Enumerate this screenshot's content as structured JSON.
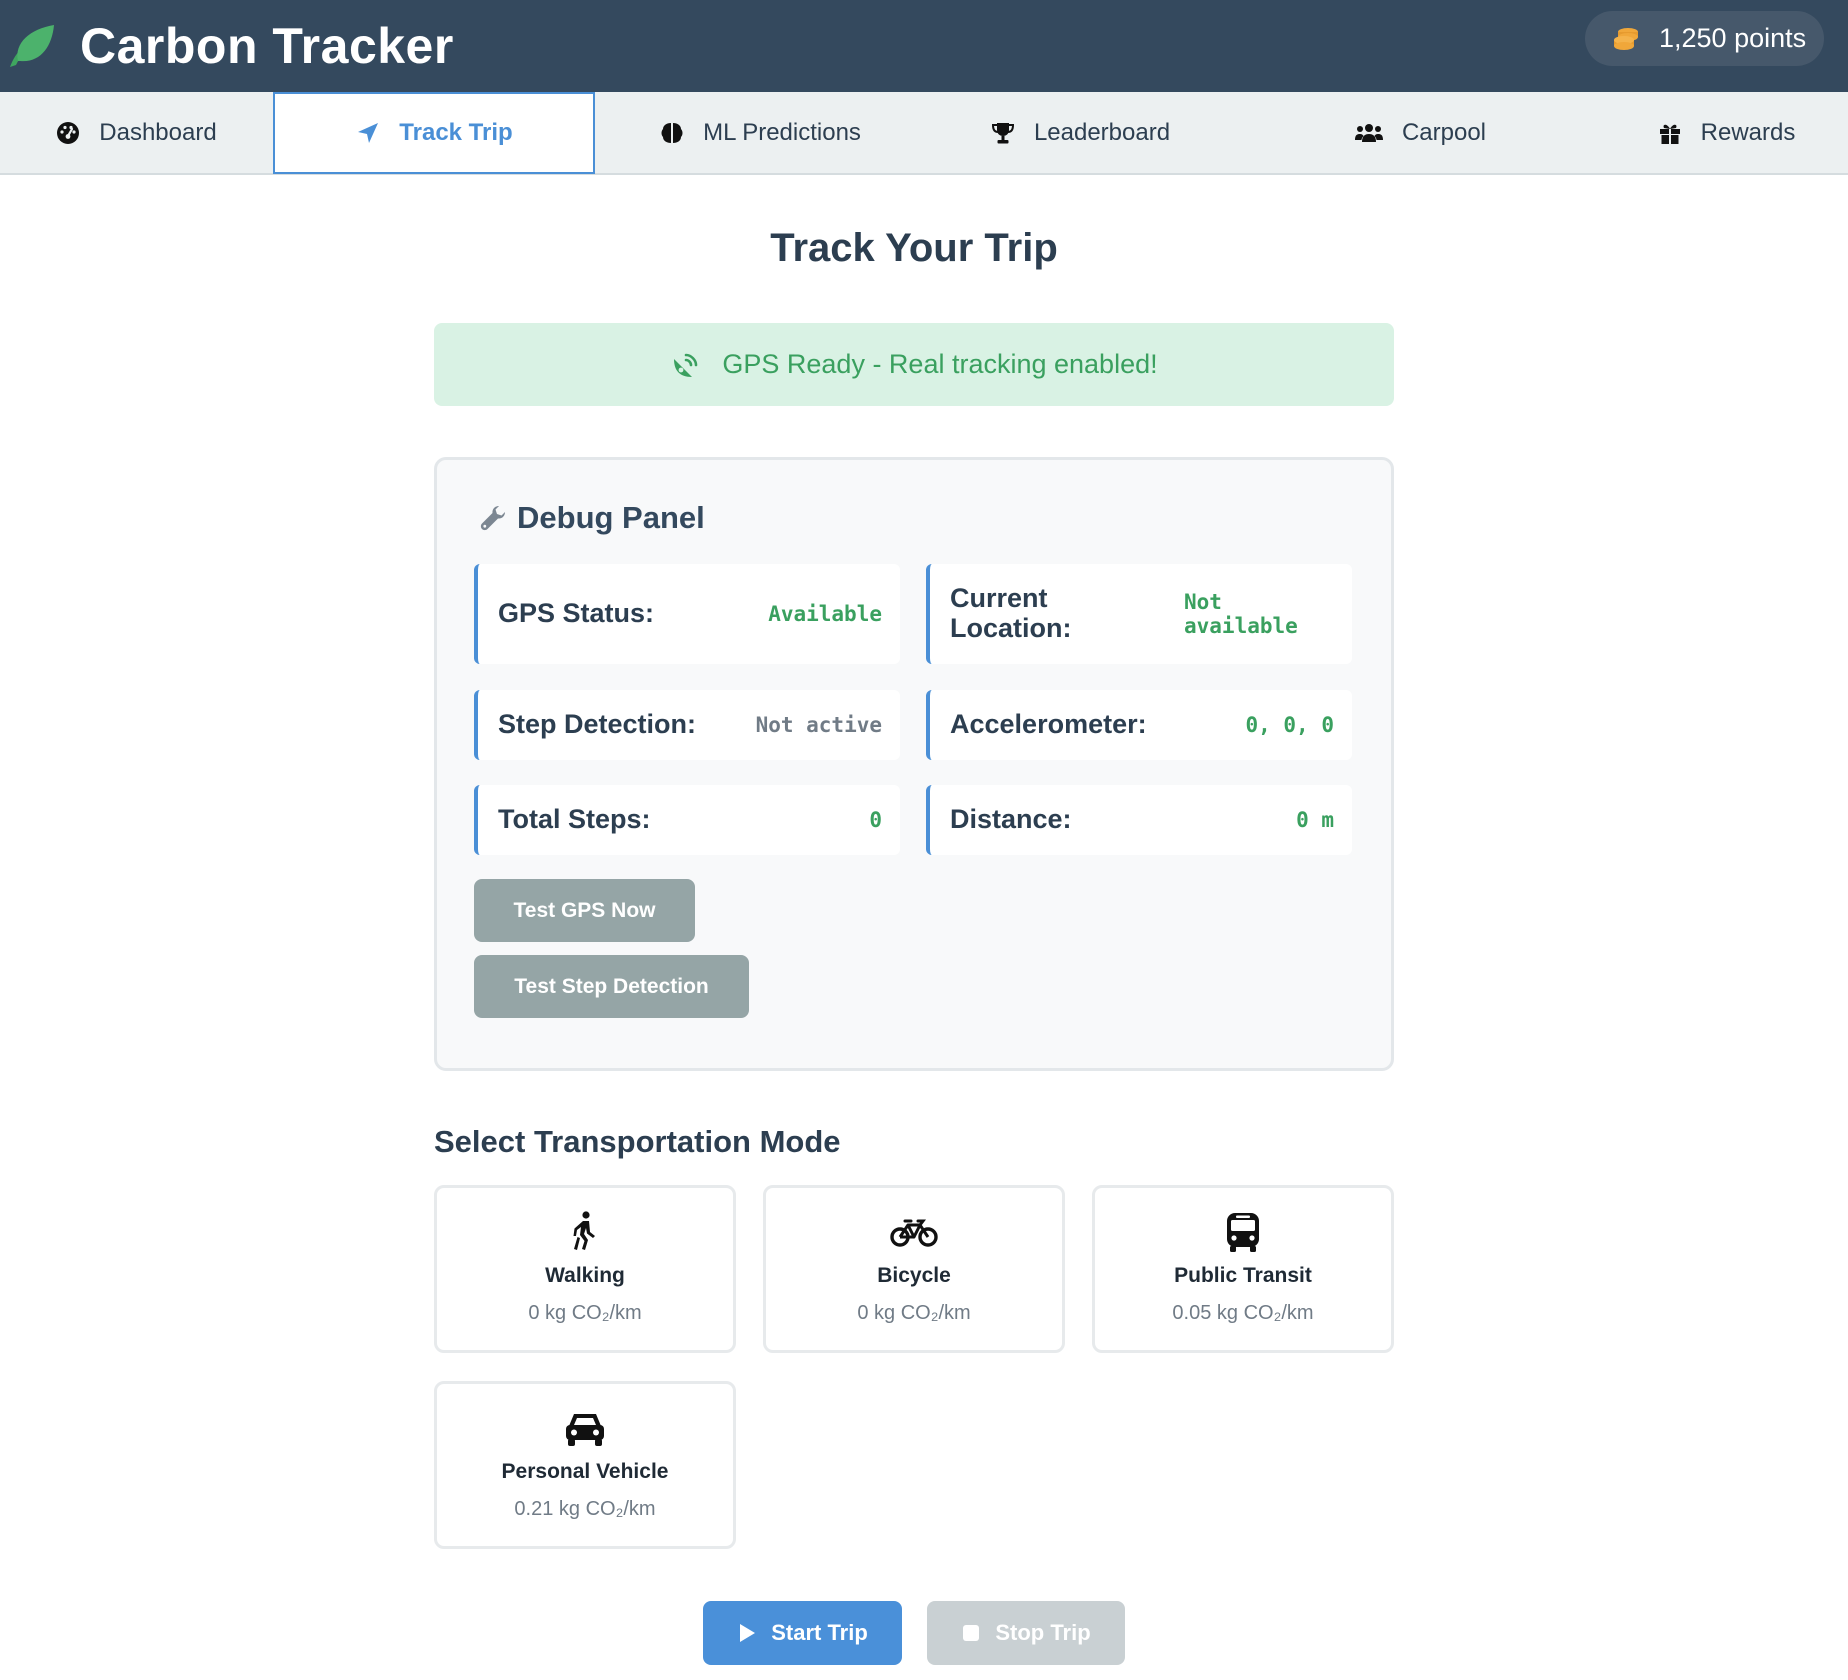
{
  "header": {
    "title": "Carbon Tracker",
    "points": "1,250 points",
    "logo_icon": "leaf-icon",
    "points_icon": "coins-icon",
    "colors": {
      "background": "#34495e",
      "accent": "#4a90d9",
      "success": "#3aa05f"
    }
  },
  "nav": {
    "tabs": [
      {
        "label": "Dashboard",
        "icon": "gauge-icon"
      },
      {
        "label": "Track Trip",
        "icon": "location-arrow-icon",
        "active": true
      },
      {
        "label": "ML Predictions",
        "icon": "brain-icon"
      },
      {
        "label": "Leaderboard",
        "icon": "trophy-icon"
      },
      {
        "label": "Carpool",
        "icon": "users-icon"
      },
      {
        "label": "Rewards",
        "icon": "gift-icon"
      }
    ]
  },
  "main": {
    "title": "Track Your Trip",
    "gps_banner": {
      "text": "GPS Ready - Real tracking enabled!",
      "icon": "satellite-dish-icon"
    },
    "debug": {
      "title": "Debug Panel",
      "icon": "wrench-icon",
      "stats": [
        {
          "label": "GPS Status:",
          "value": "Available"
        },
        {
          "label": "Current Location:",
          "value": "Not available"
        },
        {
          "label": "Step Detection:",
          "value": "Not active"
        },
        {
          "label": "Accelerometer:",
          "value": "0, 0, 0"
        },
        {
          "label": "Total Steps:",
          "value": "0"
        },
        {
          "label": "Distance:",
          "value": "0 m"
        }
      ],
      "test_gps_label": "Test GPS Now",
      "test_step_label": "Test Step Detection"
    },
    "modes_title": "Select Transportation Mode",
    "modes": [
      {
        "name": "Walking",
        "emission": "0 kg CO₂/km",
        "icon": "walking-icon"
      },
      {
        "name": "Bicycle",
        "emission": "0 kg CO₂/km",
        "icon": "bicycle-icon"
      },
      {
        "name": "Public Transit",
        "emission": "0.05 kg CO₂/km",
        "icon": "bus-icon"
      },
      {
        "name": "Personal Vehicle",
        "emission": "0.21 kg CO₂/km",
        "icon": "car-icon"
      }
    ],
    "start_label": "Start Trip",
    "stop_label": "Stop Trip"
  }
}
